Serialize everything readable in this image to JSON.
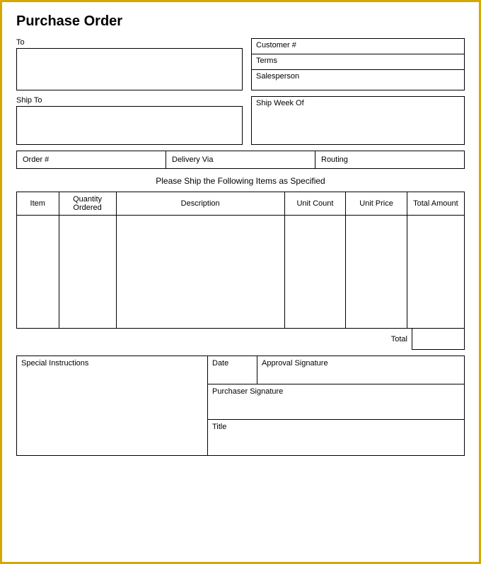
{
  "page": {
    "title": "Purchase Order",
    "border_color": "#d4a800"
  },
  "to_section": {
    "to_label": "To",
    "ship_to_label": "Ship To"
  },
  "right_fields": {
    "customer_label": "Customer #",
    "terms_label": "Terms",
    "salesperson_label": "Salesperson",
    "ship_week_label": "Ship Week Of"
  },
  "order_row": {
    "order_num_label": "Order #",
    "delivery_via_label": "Delivery Via",
    "routing_label": "Routing"
  },
  "items_section": {
    "message": "Please Ship the Following Items as Specified",
    "col_item": "Item",
    "col_qty": "Quantity Ordered",
    "col_desc": "Description",
    "col_unit_count": "Unit Count",
    "col_unit_price": "Unit Price",
    "col_total": "Total Amount",
    "total_label": "Total"
  },
  "bottom_section": {
    "special_instructions_label": "Special Instructions",
    "date_label": "Date",
    "approval_sig_label": "Approval Signature",
    "purchaser_sig_label": "Purchaser Signature",
    "title_label": "Title"
  }
}
